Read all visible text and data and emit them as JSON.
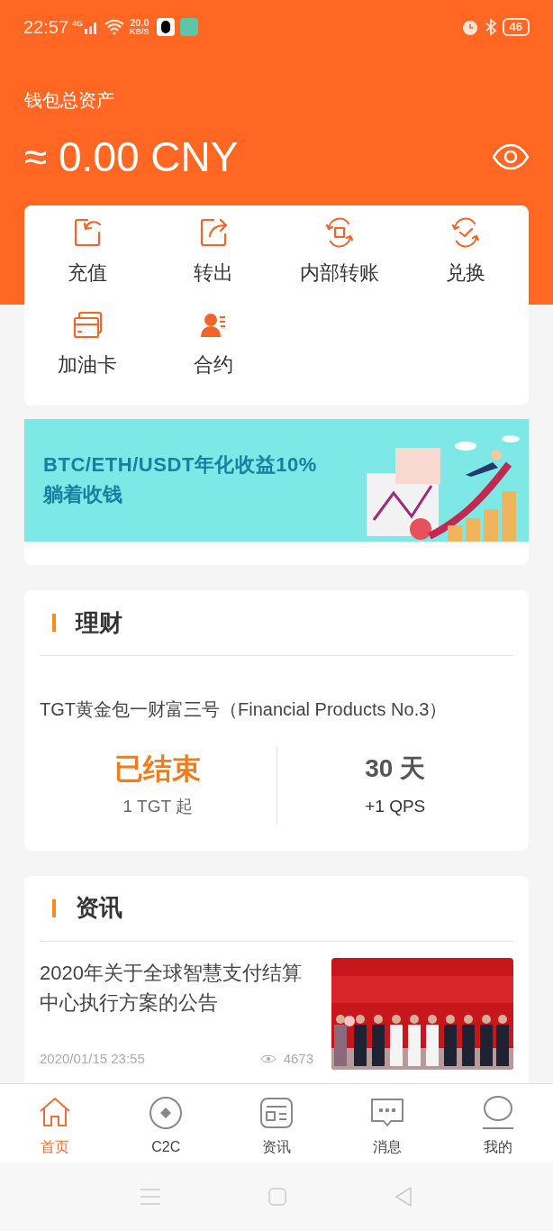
{
  "status_bar": {
    "time": "22:57",
    "network": "4G",
    "speed": "20.0",
    "speed_unit": "KB/S",
    "battery": "46"
  },
  "header": {
    "title": "钱包总资产",
    "amount": "≈ 0.00 CNY"
  },
  "actions": [
    {
      "label": "充值",
      "kind": "deposit"
    },
    {
      "label": "转出",
      "kind": "withdraw"
    },
    {
      "label": "内部转账",
      "kind": "transfer"
    },
    {
      "label": "兑换",
      "kind": "exchange"
    },
    {
      "label": "加油卡",
      "kind": "card"
    },
    {
      "label": "合约",
      "kind": "contract"
    }
  ],
  "banner": {
    "headline": "BTC/ETH/USDT年化收益10%",
    "subline": "躺着收钱"
  },
  "finance": {
    "title": "理财",
    "product": "TGT黄金包一财富三号（Financial Products No.3）",
    "status": "已结束",
    "minimum": "1 TGT 起",
    "term": "30 天",
    "reward": "+1 QPS"
  },
  "news": {
    "title": "资讯",
    "items": [
      {
        "headline": "2020年关于全球智慧支付结算中心执行方案的公告",
        "date": "2020/01/15 23:55",
        "views": "4673",
        "kind": "picture"
      }
    ]
  },
  "tabs": [
    {
      "label": "首页",
      "kind": "home",
      "selected": true
    },
    {
      "label": "C2C",
      "kind": "c2c",
      "selected": false
    },
    {
      "label": "资讯",
      "kind": "news",
      "selected": false
    },
    {
      "label": "消息",
      "kind": "message",
      "selected": false
    },
    {
      "label": "我的",
      "kind": "profile",
      "selected": false
    }
  ]
}
